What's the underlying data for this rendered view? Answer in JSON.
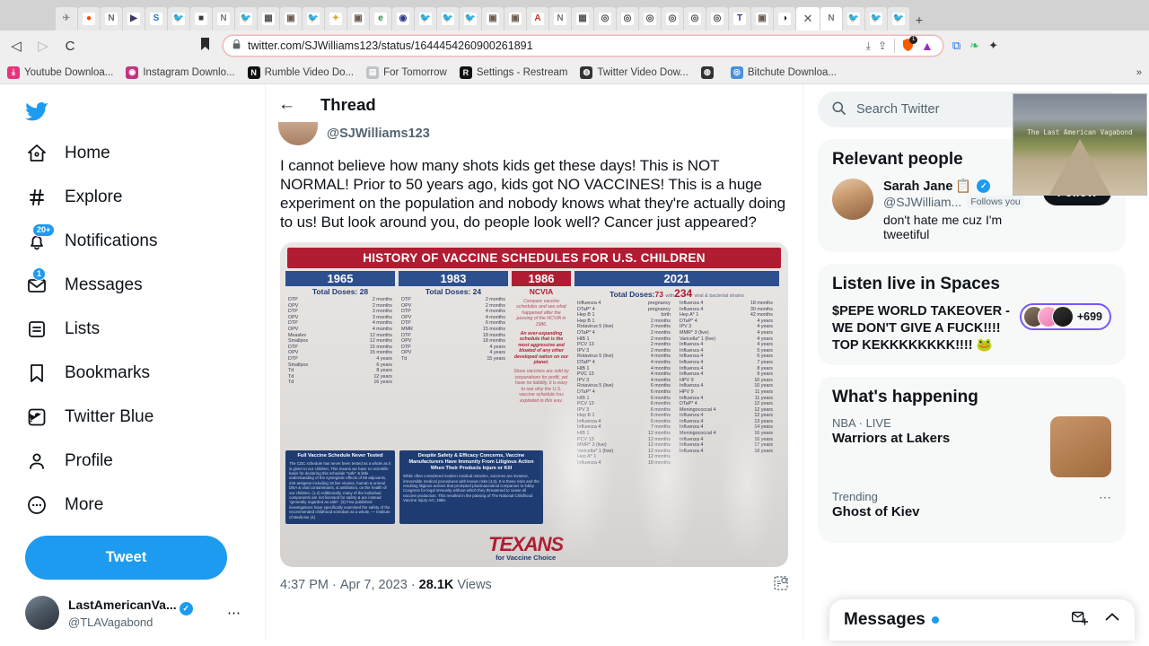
{
  "browser": {
    "tabs": [
      {
        "icon": "✈",
        "color": "#888888",
        "bg": "#e8e8e8"
      },
      {
        "icon": "●",
        "color": "#ff4500",
        "bg": "#ffffff"
      },
      {
        "icon": "N",
        "color": "#666666",
        "bg": "#ffffff"
      },
      {
        "icon": "▶",
        "color": "#3b3b5c",
        "bg": "#ffffff"
      },
      {
        "icon": "S",
        "color": "#1a73e8",
        "bg": "#ffffff"
      },
      {
        "icon": "🐦",
        "color": "#1d9bf0",
        "bg": "#ffffff"
      },
      {
        "icon": "■",
        "color": "#3a3a3a",
        "bg": "#ffffff"
      },
      {
        "icon": "N",
        "color": "#777777",
        "bg": "#ffffff"
      },
      {
        "icon": "🐦",
        "color": "#1d9bf0",
        "bg": "#ffffff"
      },
      {
        "icon": "▦",
        "color": "#555555",
        "bg": "#ffffff"
      },
      {
        "icon": "▣",
        "color": "#6b5b4a",
        "bg": "#ffffff"
      },
      {
        "icon": "🐦",
        "color": "#1d9bf0",
        "bg": "#ffffff"
      },
      {
        "icon": "✦",
        "color": "#e8a33d",
        "bg": "#ffffff"
      },
      {
        "icon": "▣",
        "color": "#6b5b4a",
        "bg": "#ffffff"
      },
      {
        "icon": "e",
        "color": "#2d8a4e",
        "bg": "#ffffff"
      },
      {
        "icon": "◉",
        "color": "#2b3a8f",
        "bg": "#ffffff"
      },
      {
        "icon": "🐦",
        "color": "#1d9bf0",
        "bg": "#ffffff"
      },
      {
        "icon": "🐦",
        "color": "#1d9bf0",
        "bg": "#ffffff"
      },
      {
        "icon": "🐦",
        "color": "#1d9bf0",
        "bg": "#ffffff"
      },
      {
        "icon": "▣",
        "color": "#6b5b4a",
        "bg": "#ffffff"
      },
      {
        "icon": "▣",
        "color": "#6b5b4a",
        "bg": "#ffffff"
      },
      {
        "icon": "A",
        "color": "#c0392b",
        "bg": "#ffffff"
      },
      {
        "icon": "N",
        "color": "#777777",
        "bg": "#ffffff"
      },
      {
        "icon": "▦",
        "color": "#555555",
        "bg": "#ffffff"
      },
      {
        "icon": "◎",
        "color": "#444444",
        "bg": "#ffffff"
      },
      {
        "icon": "◎",
        "color": "#444444",
        "bg": "#ffffff"
      },
      {
        "icon": "◎",
        "color": "#444444",
        "bg": "#ffffff"
      },
      {
        "icon": "◎",
        "color": "#444444",
        "bg": "#ffffff"
      },
      {
        "icon": "◎",
        "color": "#444444",
        "bg": "#ffffff"
      },
      {
        "icon": "◎",
        "color": "#444444",
        "bg": "#ffffff"
      },
      {
        "icon": "T",
        "color": "#2b3a8f",
        "bg": "#ffffff"
      },
      {
        "icon": "▣",
        "color": "#6b5b4a",
        "bg": "#ffffff"
      },
      {
        "icon": "◑",
        "color": "#222222",
        "bg": "#ffffff"
      },
      {
        "icon": "N",
        "color": "#777777",
        "bg": "#ffffff"
      },
      {
        "icon": "🐦",
        "color": "#1d9bf0",
        "bg": "#ffffff"
      },
      {
        "icon": "🐦",
        "color": "#1d9bf0",
        "bg": "#ffffff"
      },
      {
        "icon": "🐦",
        "color": "#1d9bf0",
        "bg": "#ffffff"
      }
    ],
    "active_tab_close": "✕",
    "new_tab_label": "+",
    "nav": {
      "back": "◁",
      "forward": "▷",
      "reload": "C",
      "bookmark_flag": "🔖"
    },
    "omnibox": {
      "lock": "🔒",
      "url": "twitter.com/SJWilliams123/status/1644454260900261891",
      "download_icon": "⤓",
      "share_icon": "⇪",
      "shield_icon": "🛡",
      "shield_badge": "1",
      "brave_icon": "▲"
    },
    "toolbar_icons": [
      "translate-icon",
      "evernote-icon",
      "extensions-icon"
    ],
    "bookmarks": [
      {
        "label": "Youtube Downloa...",
        "icon": "⤓",
        "color": "#e8327c"
      },
      {
        "label": "Instagram Downlo...",
        "icon": "◉",
        "color": "#c13584"
      },
      {
        "label": "Rumble Video Do...",
        "icon": "N",
        "color": "#111111"
      },
      {
        "label": "For Tomorrow",
        "icon": "▤",
        "color": "#bdc3c7"
      },
      {
        "label": "Settings - Restream",
        "icon": "R",
        "color": "#111111"
      },
      {
        "label": "Twitter Video Dow...",
        "icon": "◍",
        "color": "#333333"
      },
      {
        "label": "",
        "icon": "◍",
        "color": "#333333"
      },
      {
        "label": "Bitchute Downloa...",
        "icon": "◎",
        "color": "#4a90d9"
      }
    ],
    "bookmark_overflow": "»"
  },
  "overlay": {
    "caption": "The Last American Vagabond"
  },
  "sidebar": {
    "logo": "🐦",
    "items": [
      {
        "label": "Home",
        "icon": "⌂",
        "badge": ""
      },
      {
        "label": "Explore",
        "icon": "#",
        "badge": ""
      },
      {
        "label": "Notifications",
        "icon": "🔔",
        "badge": "20+"
      },
      {
        "label": "Messages",
        "icon": "✉",
        "badge": "1"
      },
      {
        "label": "Lists",
        "icon": "☰",
        "badge": ""
      },
      {
        "label": "Bookmarks",
        "icon": "🔖",
        "badge": ""
      },
      {
        "label": "Twitter Blue",
        "icon": "▣",
        "badge": ""
      },
      {
        "label": "Profile",
        "icon": "☺",
        "badge": ""
      },
      {
        "label": "More",
        "icon": "⋯",
        "badge": ""
      }
    ],
    "tweet_button": "Tweet",
    "account": {
      "name": "LastAmericanVa...",
      "handle": "@TLAVagabond",
      "verified": "✓",
      "more": "⋯"
    }
  },
  "main": {
    "back_arrow": "←",
    "title": "Thread",
    "tweet": {
      "handle": "@SJWilliams123",
      "text": "I cannot believe how many shots kids get these days! This is NOT NORMAL! Prior to 50 years ago, kids got NO VACCINES! This is a huge experiment on the population and nobody knows what they're actually doing to us! But look around you, do people look well? Cancer just appeared?",
      "time": "4:37 PM",
      "date": "Apr 7, 2023",
      "views_count": "28.1K",
      "views_label": "Views",
      "separator": "·",
      "analytics_icon": "analytics-icon"
    },
    "infographic": {
      "title": "HISTORY OF VACCINE SCHEDULES FOR U.S. CHILDREN",
      "columns": [
        {
          "year": "1965",
          "total_label": "Total Doses:",
          "total": "28",
          "rows": [
            {
              "v": "DTP",
              "age": "2 months"
            },
            {
              "v": "OPV",
              "age": "2 months"
            },
            {
              "v": "DTP",
              "age": "3 months"
            },
            {
              "v": "OPV",
              "age": "3 months"
            },
            {
              "v": "DTP",
              "age": "4 months"
            },
            {
              "v": "OPV",
              "age": "4 months"
            },
            {
              "v": "Measles",
              "age": "12 months"
            },
            {
              "v": "Smallpox",
              "age": "12 months"
            },
            {
              "v": "DTP",
              "age": "15 months"
            },
            {
              "v": "OPV",
              "age": "15 months"
            },
            {
              "v": "DTP",
              "age": "4 years"
            },
            {
              "v": "Smallpox",
              "age": "6 years"
            },
            {
              "v": "Td",
              "age": "8 years"
            },
            {
              "v": "Td",
              "age": "12 years"
            },
            {
              "v": "Td",
              "age": "16 years"
            }
          ]
        },
        {
          "year": "1983",
          "total_label": "Total Doses:",
          "total": "24",
          "rows": [
            {
              "v": "DTP",
              "age": "2 months"
            },
            {
              "v": "OPV",
              "age": "2 months"
            },
            {
              "v": "DTP",
              "age": "4 months"
            },
            {
              "v": "OPV",
              "age": "4 months"
            },
            {
              "v": "DTP",
              "age": "6 months"
            },
            {
              "v": "MMR",
              "age": "15 months"
            },
            {
              "v": "DTP",
              "age": "18 months"
            },
            {
              "v": "OPV",
              "age": "18 months"
            },
            {
              "v": "DTP",
              "age": "4 years"
            },
            {
              "v": "OPV",
              "age": "4 years"
            },
            {
              "v": "Td",
              "age": "15 years"
            }
          ]
        },
        {
          "year": "1986",
          "subtitle": "NCVIA",
          "notes": [
            "Compare vaccine schedules and see what happened after the passing of the NCVIA in 1986.",
            "An ever-expanding schedule that is the most aggressive and bloated of any other developed nation on our planet.",
            "Since vaccines are sold by corporations for profit, yet have no liability, it is easy to see why the U.S. vaccine schedule has exploded in this way."
          ]
        },
        {
          "year": "2021",
          "total_label": "Total Doses:",
          "total": "73",
          "with_label": "with",
          "strains": "234",
          "strains_note": "viral & bacterial strains",
          "rows": [
            {
              "v": "Influenza 4",
              "age": "pregnancy"
            },
            {
              "v": "DTaP* 4",
              "age": "pregnancy"
            },
            {
              "v": "Hep B 1",
              "age": "birth"
            },
            {
              "v": "Hep B 1",
              "age": "2 months"
            },
            {
              "v": "Rotavirus 5 (live)",
              "age": "2 months"
            },
            {
              "v": "DTaP* 4",
              "age": "2 months"
            },
            {
              "v": "HIB 1",
              "age": "2 months"
            },
            {
              "v": "PCV 13",
              "age": "2 months"
            },
            {
              "v": "IPV 3",
              "age": "2 months"
            },
            {
              "v": "Rotavirus 5 (live)",
              "age": "4 months"
            },
            {
              "v": "DTaP* 4",
              "age": "4 months"
            },
            {
              "v": "HIB 1",
              "age": "4 months"
            },
            {
              "v": "PVC 13",
              "age": "4 months"
            },
            {
              "v": "IPV 3",
              "age": "4 months"
            },
            {
              "v": "Rotavirus 5 (live)",
              "age": "6 months"
            },
            {
              "v": "DTaP* 4",
              "age": "6 months"
            },
            {
              "v": "HIB 1",
              "age": "6 months"
            },
            {
              "v": "PCV 13",
              "age": "6 months"
            },
            {
              "v": "IPV 3",
              "age": "6 months"
            },
            {
              "v": "Hep B 1",
              "age": "6 months"
            },
            {
              "v": "Influenza 4",
              "age": "6 months"
            },
            {
              "v": "Influenza 4",
              "age": "7 months"
            },
            {
              "v": "HIB 1",
              "age": "12 months"
            },
            {
              "v": "PCV 13",
              "age": "12 months"
            },
            {
              "v": "MMR* 3 (live)",
              "age": "12 months"
            },
            {
              "v": "Varicella* 1 (live)",
              "age": "12 months"
            },
            {
              "v": "Hep A* 1",
              "age": "12 months"
            },
            {
              "v": "Influenza 4",
              "age": "18 months"
            }
          ],
          "rows2": [
            {
              "v": "Influenza 4",
              "age": "18 months"
            },
            {
              "v": "Influenza 4",
              "age": "30 months"
            },
            {
              "v": "Hep A* 1",
              "age": "42 months"
            },
            {
              "v": "DTaP* 4",
              "age": "4 years"
            },
            {
              "v": "IPV 3",
              "age": "4 years"
            },
            {
              "v": "MMR* 3 (live)",
              "age": "4 years"
            },
            {
              "v": "Varicella* 1 (live)",
              "age": "4 years"
            },
            {
              "v": "Influenza 4",
              "age": "4 years"
            },
            {
              "v": "Influenza 4",
              "age": "5 years"
            },
            {
              "v": "Influenza 4",
              "age": "6 years"
            },
            {
              "v": "Influenza 4",
              "age": "7 years"
            },
            {
              "v": "Influenza 4",
              "age": "8 years"
            },
            {
              "v": "Influenza 4",
              "age": "9 years"
            },
            {
              "v": "HPV 9",
              "age": "10 years"
            },
            {
              "v": "Influenza 4",
              "age": "10 years"
            },
            {
              "v": "HPV 9",
              "age": "11 years"
            },
            {
              "v": "Influenza 4",
              "age": "11 years"
            },
            {
              "v": "DTaP* 4",
              "age": "12 years"
            },
            {
              "v": "Meningococcal 4",
              "age": "12 years"
            },
            {
              "v": "Influenza 4",
              "age": "12 years"
            },
            {
              "v": "Influenza 4",
              "age": "13 years"
            },
            {
              "v": "Influenza 4",
              "age": "14 years"
            },
            {
              "v": "Meningococcal 4",
              "age": "16 years"
            },
            {
              "v": "Influenza 4",
              "age": "16 years"
            },
            {
              "v": "Influenza 4",
              "age": "17 years"
            },
            {
              "v": "Influenza 4",
              "age": "18 years"
            }
          ]
        }
      ],
      "panels": [
        {
          "title": "Full Vaccine Schedule Never Tested",
          "body": "The CDC schedule has never been tested as a whole as it is given to our children. This means we have no scientific basis for declaring this schedule \"safe\" & little understanding of the synergistic effects of 59 adjuvants, 234 antigens including 18 live viruses, human & animal DNA & viral contaminants, & antibiotics, on the health of our children. (1,2)  Additionally, many of the individual components are not licensed for safety & are instead \"generally regarded as safe\". (3)  Few published investigations have specifically examined the safety of the recommended childhood schedule as a whole. — Institute of Medicine (4)"
        },
        {
          "title": "Despite Safety & Efficacy Concerns, Vaccine Manufacturers Have Immunity From Litigious Action When Their Products Injure or Kill",
          "body": "While often considered modern medical miracles, vaccines are invasive, irreversible medical procedures with known risks (4,5). It is these risks and the resulting litigious actions that prompted pharmaceutical companies to lobby Congress for legal immunity without which they threatened to cease all vaccine production.  This resulted in the passing of The National Childhood Vaccine Injury Act, 1986."
        }
      ],
      "logo": {
        "main": "TEXANS",
        "sub": "for Vaccine Choice"
      }
    }
  },
  "right": {
    "search": {
      "icon": "🔍",
      "placeholder": "Search Twitter"
    },
    "relevant_people": {
      "heading": "Relevant people",
      "person": {
        "name": "Sarah Jane",
        "name_emoji": "📋",
        "verified": "✓",
        "handle": "@SJWilliam...",
        "follows_you": "Follows you",
        "bio": "don't hate me cuz I'm tweetiful",
        "follow_label": "Follow"
      }
    },
    "spaces": {
      "heading": "Listen live in Spaces",
      "title": "$PEPE WORLD TAKEOVER - WE DON'T GIVE A FUCK!!!! TOP KEKKKKKKKK!!!! 🐸",
      "count": "+699"
    },
    "whats_happening": {
      "heading": "What's happening",
      "trends": [
        {
          "category": "NBA · LIVE",
          "title": "Warriors at Lakers",
          "has_thumb": true
        },
        {
          "category": "Trending",
          "title": "Ghost of Kiev",
          "has_thumb": false,
          "more": "⋯"
        }
      ]
    },
    "messages_dock": {
      "title": "Messages",
      "compose_icon": "✉",
      "expand_icon": "⌃"
    }
  }
}
